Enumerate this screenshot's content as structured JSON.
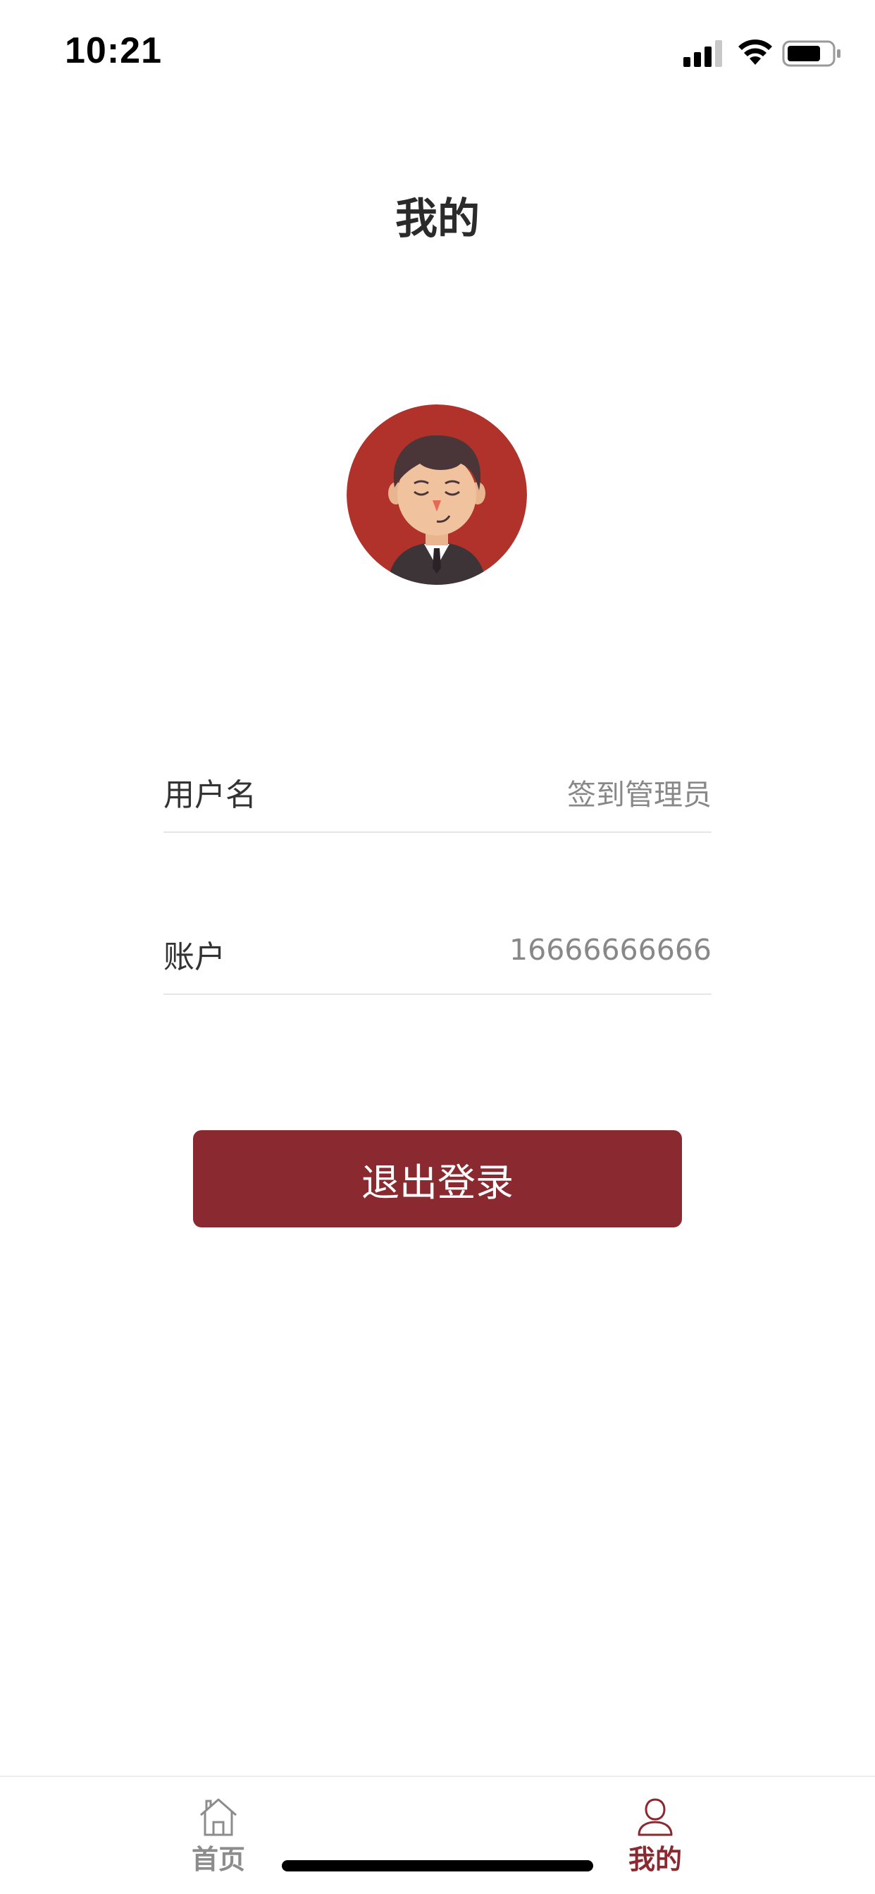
{
  "status_bar": {
    "time": "10:21",
    "signal_icon": "cellular-signal-icon",
    "wifi_icon": "wifi-icon",
    "battery_icon": "battery-icon"
  },
  "header": {
    "title": "我的"
  },
  "profile": {
    "avatar_icon": "avatar-icon",
    "rows": [
      {
        "label": "用户名",
        "value": "签到管理员"
      },
      {
        "label": "账户",
        "value": "16666666666"
      }
    ]
  },
  "actions": {
    "logout_label": "退出登录"
  },
  "tab_bar": {
    "items": [
      {
        "label": "首页",
        "icon": "home-icon",
        "active": false
      },
      {
        "label": "我的",
        "icon": "person-icon",
        "active": true
      }
    ]
  },
  "colors": {
    "accent": "#8a2a30",
    "avatar_background": "#b0322b",
    "inactive_tab": "#8c8c8c",
    "divider": "#e6e6e6"
  }
}
